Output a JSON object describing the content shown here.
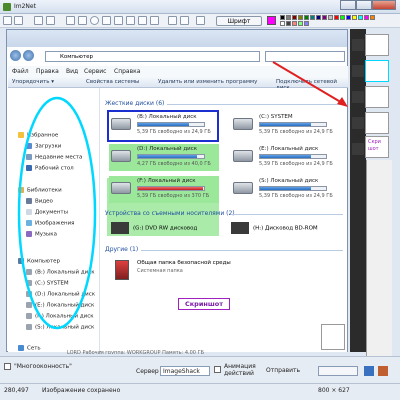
{
  "app": {
    "title": "Im2Net",
    "font_button": "Шрифт"
  },
  "explorer": {
    "address": "Компьютер",
    "menu": [
      "Файл",
      "Правка",
      "Вид",
      "Сервис",
      "Справка"
    ],
    "commands": [
      "Упорядочить ▾",
      "Свойства системы",
      "Удалить или изменить программу",
      "Подключить сетевой диск"
    ],
    "nav": {
      "favorites": "Избранное",
      "downloads": "Загрузки",
      "recent": "Недавние места",
      "desktop": "Рабочий стол",
      "libraries": "Библиотеки",
      "video": "Видео",
      "documents": "Документы",
      "images": "Изображения",
      "music": "Музыка",
      "computer": "Компьютер",
      "drives": [
        "(B:) Локальный диск",
        "(C:) SYSTEM",
        "(D:) Локальный диск",
        "(E:) Локальный диск",
        "(F:) Локальный диск",
        "(S:) Локальный диск"
      ],
      "network": "Сеть"
    },
    "hdd_group": "Жесткие диски (6)",
    "removable_group": "Устройства со съемными носителями (2)",
    "other_group": "Другие (1)",
    "drives": [
      {
        "name": "(B:) Локальный диск",
        "free": "5,39 ГБ свободно из 24,9 ГБ",
        "fill": 0.78
      },
      {
        "name": "(C:) SYSTEM",
        "free": "5,39 ГБ свободно из 24,9 ГБ",
        "fill": 0.78
      },
      {
        "name": "(D:) Локальный диск",
        "free": "4,27 ГБ свободно из 40,0 ГБ",
        "fill": 0.89
      },
      {
        "name": "(E:) Локальный диск",
        "free": "5,39 ГБ свободно из 24,9 ГБ",
        "fill": 0.78
      },
      {
        "name": "(F:) Локальный диск",
        "free": "5,39 ГБ свободно из 370 ГБ",
        "fill": 0.98
      },
      {
        "name": "(S:) Локальный диск",
        "free": "5,39 ГБ свободно из 24,9 ГБ",
        "fill": 0.78
      }
    ],
    "removable": [
      "(G:) DVD RW дисковод",
      "(H:) Дисковод BD-ROM"
    ],
    "other": {
      "name": "Общая папка безопасной среды",
      "type": "Системная папка"
    },
    "screenshot_label": "Скриншот",
    "status_partial": "LORD  Рабочая группа: WORKGROUP   Память: 4,00 ГБ"
  },
  "side_thumb_label": "Скри шот",
  "bottom": {
    "multiwindow": "\"Многооконность\"",
    "server_label": "Сервер",
    "server_value": "ImageShack",
    "animation": "Анимация действий",
    "send": "Отправить",
    "coords": "280,497",
    "status": "Изображение сохранено",
    "size": "800 × 627"
  },
  "colors": {
    "accent": "#1b2fd0",
    "highlight": "#9be89b",
    "annotation": "#00d8ff",
    "arrow": "#e02020",
    "label": "#7a18a8"
  }
}
